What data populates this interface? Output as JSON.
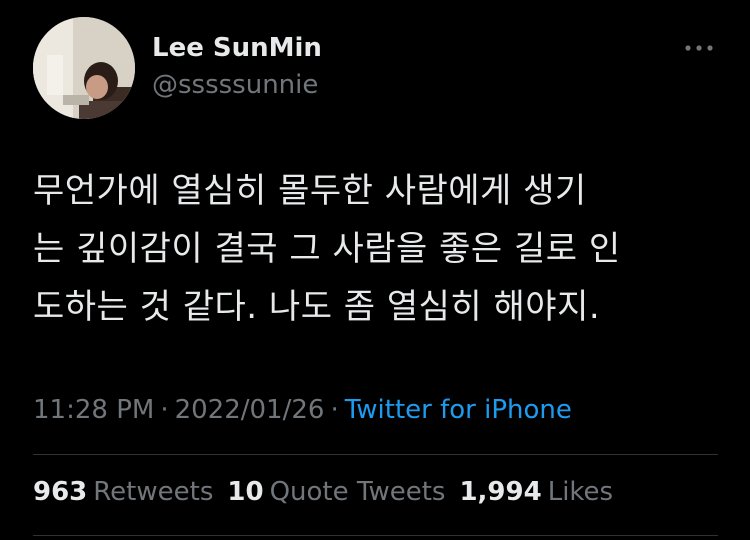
{
  "author": {
    "display_name": "Lee SunMin",
    "handle": "@sssssunnie",
    "avatar_icon": "profile-photo"
  },
  "tweet": {
    "lines": [
      "무언가에 열심히 몰두한 사람에게 생기",
      "는 깊이감이 결국 그 사람을 좋은 길로 인",
      "도하는 것 같다. 나도 좀 열심히 해야지."
    ],
    "time": "11:28 PM",
    "separator": "·",
    "date": "2022/01/26",
    "source": "Twitter for iPhone"
  },
  "stats": {
    "retweets_count": "963",
    "retweets_label": "Retweets",
    "quotes_count": "10",
    "quotes_label": "Quote Tweets",
    "likes_count": "1,994",
    "likes_label": "Likes"
  },
  "icons": {
    "more": "more-horizontal-icon"
  },
  "colors": {
    "background": "#000000",
    "primary_text": "#e7e9ea",
    "secondary_text": "#71767b",
    "link": "#1d9bf0",
    "divider": "#2f3336"
  }
}
